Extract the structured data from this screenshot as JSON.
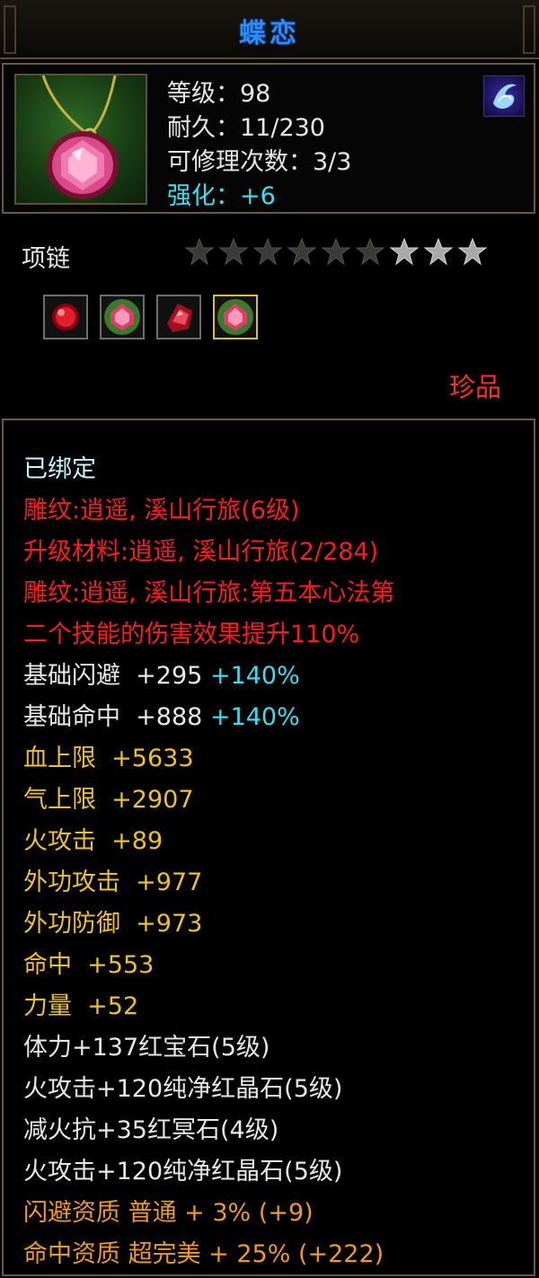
{
  "item": {
    "name": "蝶恋",
    "level": "等级：98",
    "durability": "耐久：11/230",
    "repairs": "可修理次数：3/3",
    "enhance": "强化：+6",
    "type": "项链",
    "stars_lit": 6,
    "stars_total": 9,
    "rarity": "珍品"
  },
  "icons": {
    "item": "pendant-necklace-icon",
    "school": "school-emblem-icon",
    "slots": [
      "ruby-gem-icon",
      "pink-crystal-gem-icon",
      "red-crystal-gem-icon",
      "pink-crystal-gem-icon"
    ]
  },
  "colors": {
    "title": "#2a8cff",
    "enhance": "#35e0f0",
    "rarity": "#ff2a2a",
    "attribute_red": "#ff1a1a",
    "attribute_yellow": "#f0c21e",
    "attribute_orange": "#f09a1e"
  },
  "bound": "已绑定",
  "engrave": {
    "line1": "雕纹:逍遥, 溪山行旅(6级)",
    "line2": "升级材料:逍遥, 溪山行旅(2/284)",
    "line3": "雕纹:逍遥, 溪山行旅:第五本心法第",
    "line4": "二个技能的伤害效果提升110%"
  },
  "base": [
    {
      "label": "基础闪避",
      "value": "+295",
      "bonus": "+140%"
    },
    {
      "label": "基础命中",
      "value": "+888",
      "bonus": "+140%"
    }
  ],
  "stats": [
    {
      "label": "血上限",
      "value": "+5633"
    },
    {
      "label": "气上限",
      "value": "+2907"
    },
    {
      "label": "火攻击",
      "value": "+89"
    },
    {
      "label": "外功攻击",
      "value": "+977"
    },
    {
      "label": "外功防御",
      "value": "+973"
    },
    {
      "label": "命中",
      "value": "+553"
    },
    {
      "label": "力量",
      "value": "+52"
    }
  ],
  "gems": [
    "体力+137红宝石(5级)",
    "火攻击+120纯净红晶石(5级)",
    "减火抗+35红冥石(4级)",
    "火攻击+120纯净红晶石(5级)"
  ],
  "aptitude": [
    "闪避资质 普通 + 3% (+9)",
    "命中资质 超完美 + 25% (+222)"
  ]
}
